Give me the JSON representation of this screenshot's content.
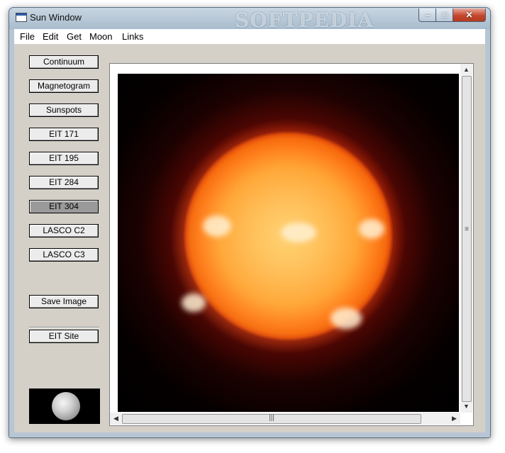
{
  "window": {
    "title": "Sun Window",
    "watermark": "SOFTPEDIA"
  },
  "menu": [
    "File",
    "Edit",
    "Get",
    "Moon",
    "Links"
  ],
  "buttons": {
    "continuum": "Continuum",
    "magnetogram": "Magnetogram",
    "sunspots": "Sunspots",
    "eit171": "EIT 171",
    "eit195": "EIT 195",
    "eit284": "EIT 284",
    "eit304": "EIT 304",
    "lascoc2": "LASCO C2",
    "lascoc3": "LASCO C3",
    "save_image": "Save Image",
    "eit_site": "EIT Site"
  },
  "selected_filter": "EIT 304",
  "colors": {
    "sun": "#ff7410",
    "panel": "#d4d0c8",
    "close_button": "#c5472c"
  },
  "icons": {
    "minimize": "minimize-icon",
    "maximize": "maximize-icon",
    "close": "close-icon"
  }
}
